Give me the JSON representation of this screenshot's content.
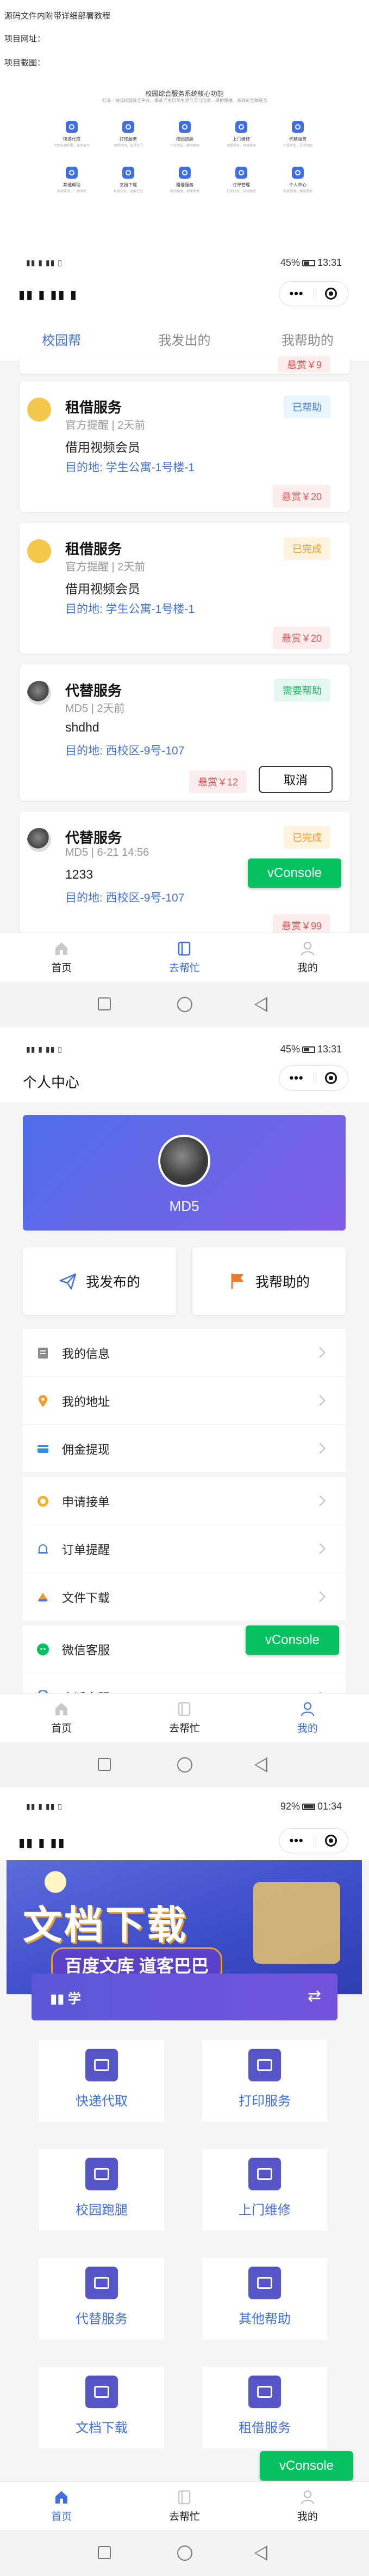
{
  "doc": {
    "intro_line": "源码文件内附带详细部署教程",
    "project_url": "项目网址：",
    "project_screens": "项目截图："
  },
  "features": {
    "title": "校园综合服务系统核心功能",
    "subtitle": "打造一站式校园服务平台，覆盖学生日常生活与学习场景，提供便捷、高效的互助服务",
    "items": [
      {
        "name": "快递代取",
        "desc": "代取快递包裹，省时省力"
      },
      {
        "name": "打印服务",
        "desc": "资料打印，送货上门"
      },
      {
        "name": "校园跑腿",
        "desc": "代买代送，随叫随到"
      },
      {
        "name": "上门维修",
        "desc": "电脑手机，快速维修"
      },
      {
        "name": "代替服务",
        "desc": "代课代签，灵活互助"
      },
      {
        "name": "其他帮助",
        "desc": "各类需求，一键发布"
      },
      {
        "name": "文档下载",
        "desc": "百度文库，道客巴巴"
      },
      {
        "name": "租借服务",
        "desc": "物品租借，按需使用"
      },
      {
        "name": "订单管理",
        "desc": "订单状态，实时跟踪"
      },
      {
        "name": "个人中心",
        "desc": "信息管理，佣金提现"
      }
    ]
  },
  "screen1": {
    "status_left": "▮▮ ▮ ▮▮ ▯",
    "status_right": "45%",
    "time": "13:31",
    "title_masked": "▮▮ ▮ ▮▮ ▮",
    "capsule_dots": "•••",
    "tabs": [
      "校园帮",
      "我发出的",
      "我帮助的"
    ],
    "top_reward_partial": "悬赏￥9",
    "cards": [
      {
        "name": "租借服务",
        "meta": "官方提醒 | 2天前",
        "desc": "借用视频会员",
        "dest": "目的地: 学生公寓-1号楼-1",
        "badge": "已帮助",
        "badge_type": "help",
        "reward": "悬赏￥20"
      },
      {
        "name": "租借服务",
        "meta": "官方提醒 | 2天前",
        "desc": "借用视频会员",
        "dest": "目的地: 学生公寓-1号楼-1",
        "badge": "已完成",
        "badge_type": "done",
        "reward": "悬赏￥20"
      },
      {
        "name": "代替服务",
        "meta": "MD5 | 2天前",
        "desc": "shdhd",
        "dest": "目的地: 西校区-9号-107",
        "badge": "需要帮助",
        "badge_type": "need",
        "reward": "悬赏￥12",
        "action": "取消"
      },
      {
        "name": "代替服务",
        "meta": "MD5 | 6-21 14:56",
        "desc": "1233",
        "dest": "目的地: 西校区-9号-107",
        "badge": "已完成",
        "badge_type": "done",
        "reward": "悬赏￥99"
      }
    ],
    "vconsole": "vConsole",
    "tabbar": [
      "首页",
      "去帮忙",
      "我的"
    ]
  },
  "screen2": {
    "status_left": "▮▮ ▮ ▮▮ ▯",
    "status_right": "45%",
    "time": "13:31",
    "title": "个人中心",
    "capsule_dots": "•••",
    "username": "MD5",
    "btn_posted": "我发布的",
    "btn_helped": "我帮助的",
    "menu1": [
      "我的信息",
      "我的地址",
      "佣金提现"
    ],
    "menu2": [
      "申请接单",
      "订单提醒",
      "文件下载"
    ],
    "menu3": [
      "微信客服",
      "电话客服"
    ],
    "vconsole": "vConsole",
    "tabbar": [
      "首页",
      "去帮忙",
      "我的"
    ]
  },
  "screen3": {
    "status_left": "▮▮ ▮ ▮▮ ▯",
    "status_right": "92%",
    "time": "01:34",
    "title_masked": "▮▮ ▮ ▮▮",
    "capsule_dots": "•••",
    "hero_title": "文档下载",
    "hero_sub": "百度文库 道客巴巴",
    "school": "▮▮ 学",
    "switch_icon": "⇄",
    "services": [
      "快递代取",
      "打印服务",
      "校园跑腿",
      "上门维修",
      "代替服务",
      "其他帮助",
      "文档下载",
      "租借服务"
    ],
    "vconsole": "vConsole",
    "tabbar": [
      "首页",
      "去帮忙",
      "我的"
    ]
  },
  "colors": {
    "accent": "#3f6fe0",
    "vconsole": "#07c160",
    "reward": "#e05555",
    "banner_start": "#4f6de8",
    "banner_end": "#7f5ee6"
  },
  "icons": [
    "home-icon",
    "help-icon",
    "user-icon",
    "send-icon",
    "flag-icon",
    "chevron-right-icon",
    "switch-icon"
  ]
}
